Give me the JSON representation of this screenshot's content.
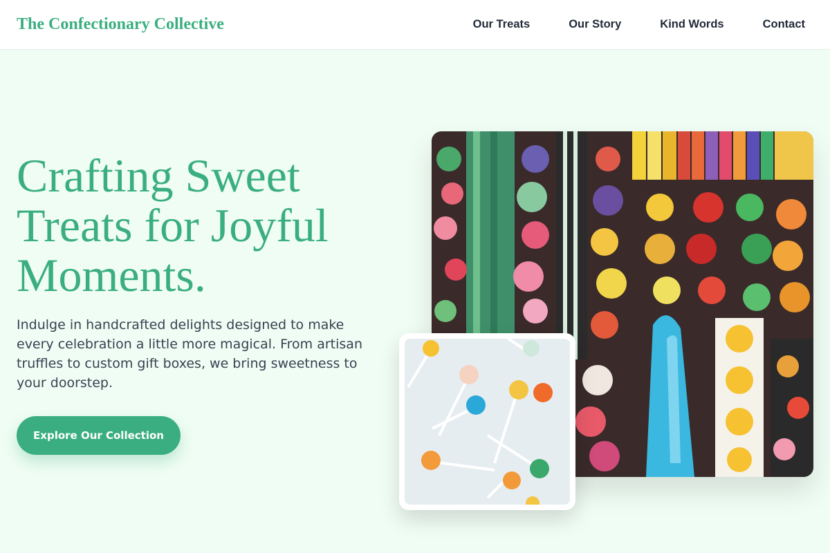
{
  "brand": "The Confectionary Collective",
  "nav": {
    "items": [
      {
        "label": "Our Treats"
      },
      {
        "label": "Our Story"
      },
      {
        "label": "Kind Words"
      },
      {
        "label": "Contact"
      }
    ]
  },
  "hero": {
    "title_lines": [
      "Crafting Sweet",
      "Treats for Joyful",
      "Moments."
    ],
    "description": "Indulge in handcrafted delights designed to make every celebration a little more magical. From artisan truffles to custom gift boxes, we bring sweetness to your doorstep.",
    "cta_label": "Explore Our Collection"
  },
  "images": {
    "main": "candy-assortment-photo",
    "secondary": "lollipops-photo"
  },
  "colors": {
    "accent": "#3aae80",
    "background": "#f0fdf4",
    "nav_background": "#ffffff",
    "text": "#1f2937",
    "body_text": "#374151"
  }
}
